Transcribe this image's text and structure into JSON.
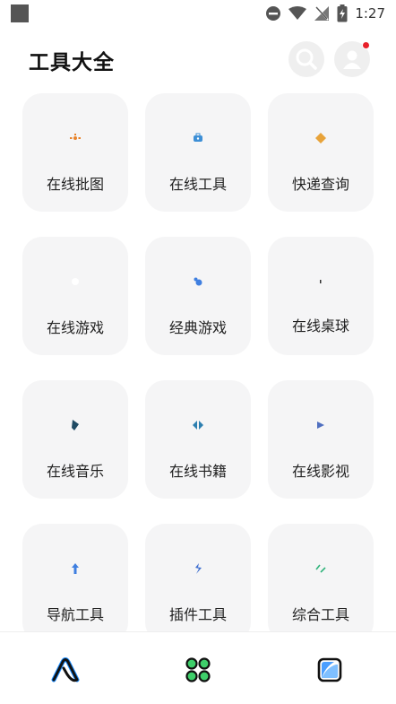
{
  "status_bar": {
    "time": "1:27",
    "icons": [
      "app-icon",
      "do-not-disturb-icon",
      "wifi-icon",
      "no-signal-icon",
      "battery-charging-icon"
    ]
  },
  "header": {
    "title": "工具大全",
    "search_icon": "search-icon",
    "profile_icon": "profile-icon",
    "has_notification": true
  },
  "tiles": [
    {
      "label": "在线批图",
      "icon": "image-edit-icon",
      "color": "#e8832a"
    },
    {
      "label": "在线工具",
      "icon": "toolbox-icon",
      "color": "#3d8fd6"
    },
    {
      "label": "快递查询",
      "icon": "diamond-icon",
      "color": "#e8a33a"
    },
    {
      "label": "在线游戏",
      "icon": "dot-icon",
      "color": "#ffffff"
    },
    {
      "label": "经典游戏",
      "icon": "game-icon",
      "color": "#3f7fe0"
    },
    {
      "label": "在线桌球",
      "icon": "billiards-icon",
      "color": "#333333"
    },
    {
      "label": "在线音乐",
      "icon": "music-icon",
      "color": "#1f4a63"
    },
    {
      "label": "在线书籍",
      "icon": "book-icon",
      "color": "#2d7fb0"
    },
    {
      "label": "在线影视",
      "icon": "play-icon",
      "color": "#4f6fc0"
    },
    {
      "label": "导航工具",
      "icon": "arrow-up-icon",
      "color": "#3f7fe0"
    },
    {
      "label": "插件工具",
      "icon": "plugin-icon",
      "color": "#3f6fd0"
    },
    {
      "label": "综合工具",
      "icon": "tools-icon",
      "color": "#2fb37a"
    }
  ],
  "bottom_nav": [
    {
      "name": "home",
      "icon": "home-logo-icon"
    },
    {
      "name": "apps",
      "icon": "apps-grid-icon"
    },
    {
      "name": "gallery",
      "icon": "gallery-icon"
    }
  ],
  "colors": {
    "tile_bg": "#f5f5f6",
    "accent_blue": "#1a8cff",
    "notification_red": "#e8202a"
  }
}
